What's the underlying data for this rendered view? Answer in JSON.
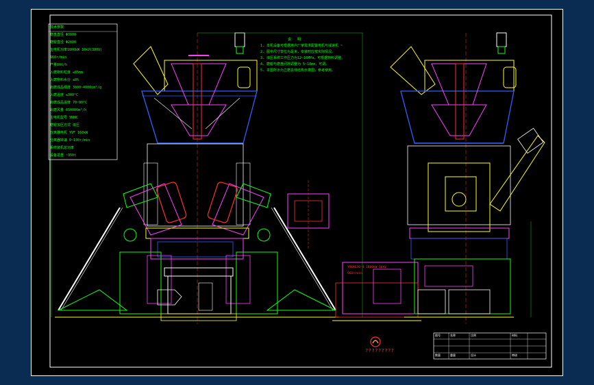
{
  "specs_table": {
    "rows": [
      "技术参数",
      "磨盘直径 Φ3800",
      "磨辊直径 Φ2800",
      "主电机功率1800kW 10kV(380V)",
      "960r/min",
      "产量80t/h",
      "入磨物料粒度 ≤85mm",
      "入磨物料水分 ≤8%",
      "出磨成品细度 3000~4000cm²/g",
      "入磨温度 ≤300°C",
      "出磨成品温度 70~90°C",
      "出磨风量 650000m³/h",
      "主电机型号 YRKK",
      "磨辊加压方式 液压",
      "分离器电机 YVF 160kW",
      "分离器转速 0~130r/min",
      "系统装机总功率",
      "设备总重 ~350t"
    ]
  },
  "notes": {
    "lines": [
      "说 明",
      "1. 本机设备可根据用户厂家需求配置电机与减速机 ~",
      "2. 图中尺寸单位为毫米，安装时应按实际情况。",
      "3. 液压系统工作压力为12~16MPa，可根据物料调整。",
      "4. 磨辊与磨盘间隙调整为 5~10mm，可调。",
      "5. 本图所示为立磨总体结构示意图，参考使用。"
    ]
  },
  "motor_block": {
    "lines": [
      "YRKK630-4 1800kW 10kV",
      "960r/min"
    ]
  },
  "logo": {
    "caption": "?????????"
  },
  "title_block": {
    "cells": [
      "图号",
      "名称",
      "比例",
      "材料",
      "数量",
      "重量",
      "设计",
      "审核"
    ]
  },
  "colors": {
    "sheet": "#000000",
    "frame": "#ffffff",
    "green": "#10ff10",
    "yellow": "#ffff20",
    "magenta": "#ff40ff",
    "cyan": "#30e0ff",
    "blue": "#3060ff",
    "red": "#ff3030",
    "white": "#ffffff"
  }
}
